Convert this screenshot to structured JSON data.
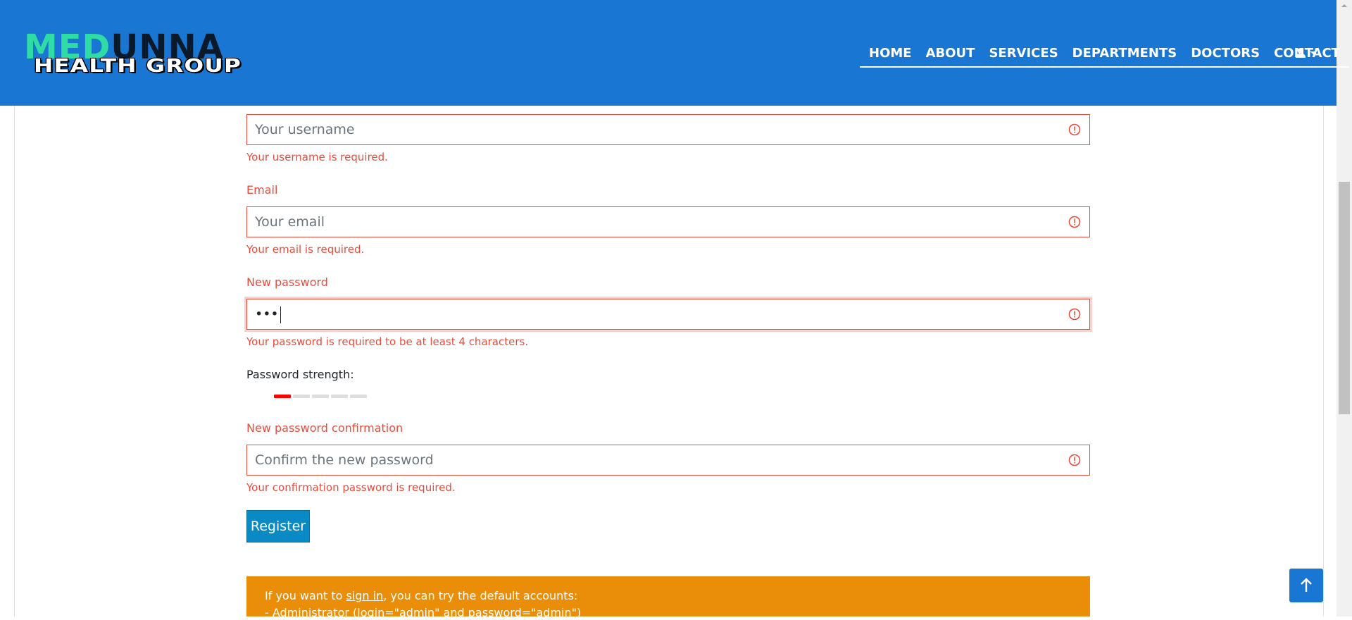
{
  "header": {
    "logo_top_a": "MED",
    "logo_top_b": "UNNA",
    "logo_bottom": "HEALTH GROUP",
    "nav": [
      "HOME",
      "ABOUT",
      "SERVICES",
      "DEPARTMENTS",
      "DOCTORS",
      "CONTACT"
    ],
    "user_menu_icon": "user-caret-icon"
  },
  "form": {
    "username": {
      "placeholder": "Your username",
      "error": "Your username is required."
    },
    "email": {
      "label": "Email",
      "placeholder": "Your email",
      "error": "Your email is required."
    },
    "password": {
      "label": "New password",
      "value": "•••",
      "error": "Your password is required to be at least 4 characters."
    },
    "strength": {
      "label": "Password strength:",
      "level": 1,
      "max": 5
    },
    "confirm": {
      "label": "New password confirmation",
      "placeholder": "Confirm the new password",
      "error": "Your confirmation password is required."
    },
    "submit_label": "Register"
  },
  "alert": {
    "line1_prefix": "If you want to ",
    "line1_link": "sign in",
    "line1_suffix": ", you can try the default accounts:",
    "line2": "- Administrator (login=\"admin\" and password=\"admin\")"
  },
  "colors": {
    "header": "#1976d2",
    "error": "#e74c3c",
    "register": "#0a8ac4",
    "alert": "#ea8e09"
  }
}
